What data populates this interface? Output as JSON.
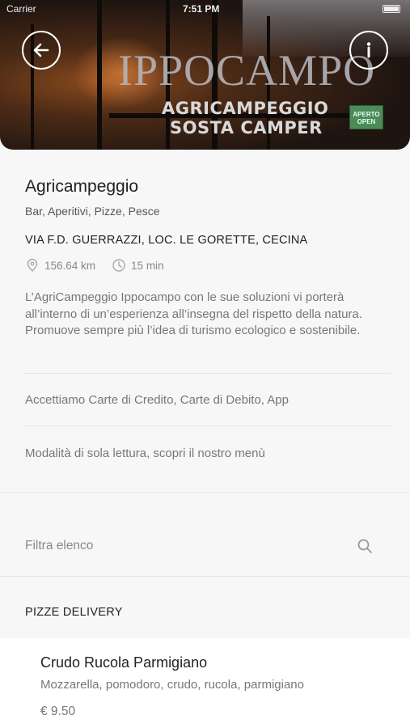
{
  "status_bar": {
    "carrier": "Carrier",
    "time": "7:51 PM"
  },
  "hero": {
    "brand": "IPPOCAMPO",
    "subtitle_line1": "AGRICAMPEGGIO",
    "subtitle_line2": "SOSTA CAMPER",
    "sign_text": "APERTO OPEN"
  },
  "venue": {
    "title": "Agricampeggio",
    "categories": "Bar, Aperitivi, Pizze, Pesce",
    "address": "VIA F.D. GUERRAZZI, LOC. LE GORETTE, CECINA",
    "distance": "156.64 km",
    "travel_time": "15 min",
    "description": "L’AgriCampeggio Ippocampo con le sue soluzioni vi porterà all’interno di un’esperienza all’insegna del rispetto della natura. Promuove sempre più l’idea di turismo ecologico e sostenibile.",
    "payments": "Accettiamo Carte di Credito, Carte di Debito, App",
    "read_only_notice": "Modalità di sola lettura, scopri il nostro menù"
  },
  "filter": {
    "placeholder": "Filtra elenco"
  },
  "menu": {
    "section_title": "PIZZE DELIVERY",
    "items": [
      {
        "name": "Crudo Rucola Parmigiano",
        "ingredients": "Mozzarella, pomodoro, crudo, rucola, parmigiano",
        "price": "€ 9.50"
      }
    ]
  },
  "icons": {
    "back": "arrow-left-icon",
    "info": "info-icon",
    "location": "location-pin-icon",
    "clock": "clock-icon",
    "search": "search-icon"
  }
}
